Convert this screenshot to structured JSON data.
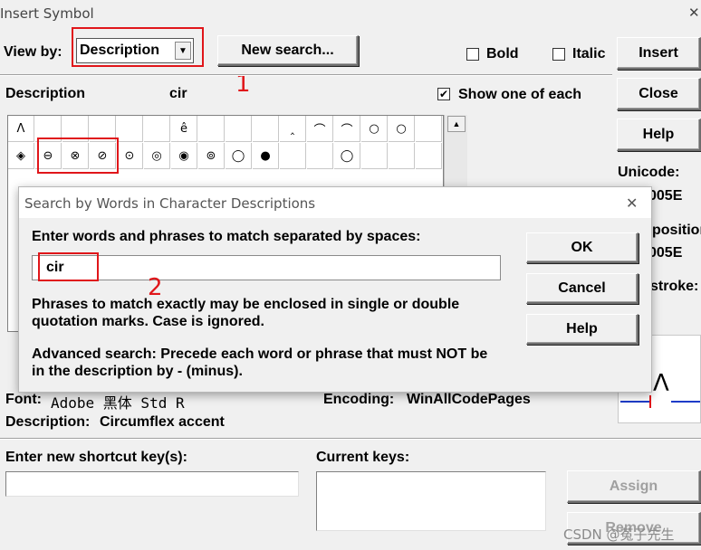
{
  "window": {
    "title": "Insert Symbol",
    "close_glyph": "✕"
  },
  "toolbar": {
    "view_by_label": "View by:",
    "view_by_value": "Description",
    "new_search_label": "New search...",
    "bold_label": "Bold",
    "italic_label": "Italic"
  },
  "side_buttons": {
    "insert": "Insert",
    "close": "Close",
    "help": "Help"
  },
  "description_row": {
    "label": "Description",
    "value": "cir",
    "show_one_label": "Show one of each",
    "show_one_checked": "✔"
  },
  "info": {
    "unicode_label": "Unicode:",
    "unicode_value": "005E",
    "position_label": "position",
    "position_value": "005E",
    "stroke_label": "stroke:"
  },
  "grid": {
    "row1": [
      "Λ",
      "",
      "",
      "",
      "",
      "",
      "ê",
      "",
      "",
      "",
      "‸",
      "⌒",
      "⌒",
      "○",
      "○",
      ""
    ],
    "row2": [
      "◈",
      "⊖",
      "⊗",
      "⊘",
      "⊙",
      "◎",
      "◉",
      "⊚",
      "◯",
      "●",
      "",
      "",
      "◯",
      "",
      "",
      ""
    ]
  },
  "search_dialog": {
    "title": "Search by Words in Character Descriptions",
    "close_glyph": "✕",
    "prompt": "Enter words and phrases to match separated by spaces:",
    "input_value": "cir",
    "note1_line1": "Phrases to match exactly may be enclosed in single or double",
    "note1_line2": "quotation marks. Case is ignored.",
    "note2_line1": "Advanced search: Precede each word or phrase that must NOT be",
    "note2_line2": "in the description by - (minus).",
    "ok": "OK",
    "cancel": "Cancel",
    "help": "Help"
  },
  "font_info": {
    "font_label": "Font:",
    "font_value": "Adobe 黑体 Std R",
    "encoding_label": "Encoding:",
    "encoding_value": "WinAllCodePages",
    "description_label": "Description:",
    "description_value": "Circumflex accent"
  },
  "preview": {
    "glyph": "Λ"
  },
  "shortcut": {
    "new_label": "Enter new shortcut key(s):",
    "current_label": "Current keys:",
    "assign": "Assign",
    "remove": "Remove"
  },
  "annotations": {
    "one": "1",
    "two": "2",
    "accent_color": "#e0161a"
  },
  "watermark": "CSDN @菟子先生"
}
